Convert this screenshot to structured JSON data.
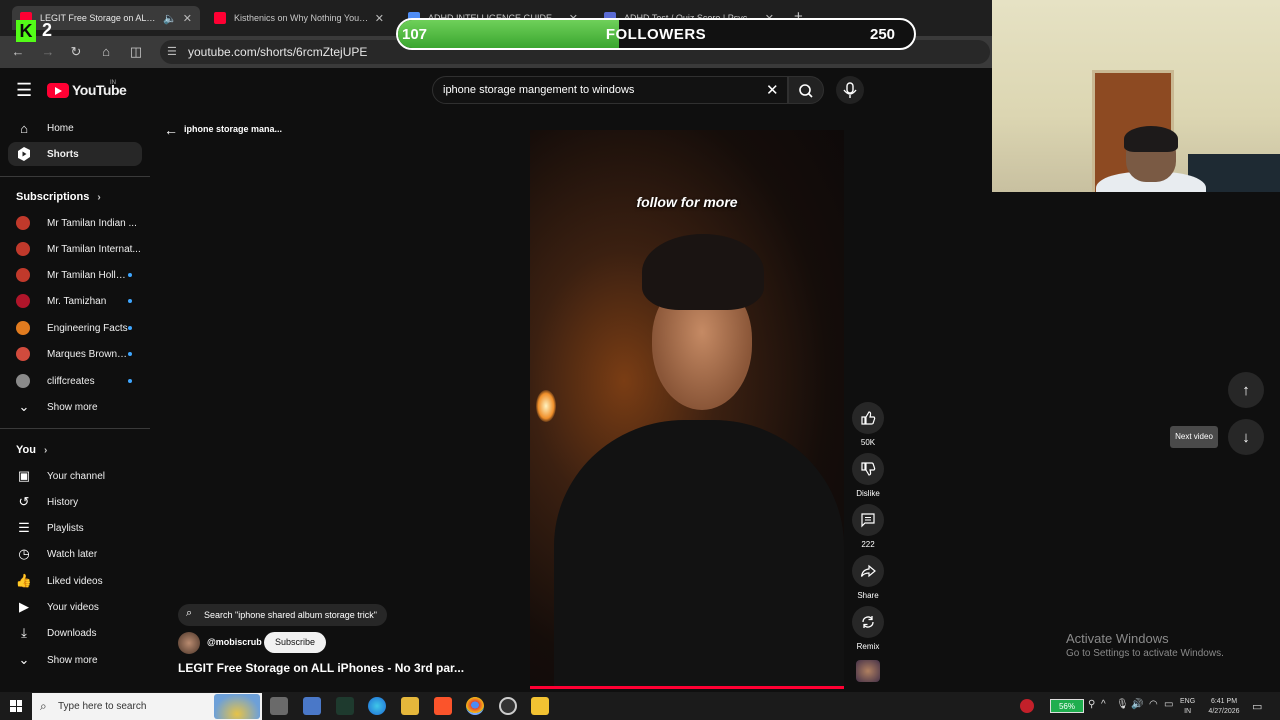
{
  "browser": {
    "tabs": [
      {
        "title": "LEGIT Free Storage on ALL iPhones",
        "favicon_color": "#ff0033",
        "active": true
      },
      {
        "title": "Kisthenics on Why Nothing You Chase",
        "favicon_color": "#ff0033",
        "active": false
      },
      {
        "title": "ADHD INTELLIGENCE GUIDE - Google",
        "favicon_color": "#4f8df5",
        "active": false
      },
      {
        "title": "ADHD Test / Quiz Score | Psychology",
        "favicon_color": "#5b6bd4",
        "active": false
      }
    ],
    "new_tab": "+",
    "url": "youtube.com/shorts/6rcmZtejUPE"
  },
  "overlay": {
    "kick_logo": "K",
    "kick_count": "2",
    "followers": {
      "current": "107",
      "label": "FOLLOWERS",
      "goal": "250",
      "progress_fraction": 0.428
    }
  },
  "header": {
    "logo_text": "YouTube",
    "logo_region": "IN",
    "search_value": "iphone storage mangement to windows"
  },
  "sidebar": {
    "main": [
      {
        "label": "Home",
        "icon": "home-icon"
      },
      {
        "label": "Shorts",
        "icon": "shorts-icon",
        "active": true
      }
    ],
    "subscriptions_title": "Subscriptions",
    "subscriptions": [
      {
        "label": "Mr Tamilan Indian ...",
        "color": "#c0392b",
        "dot": false
      },
      {
        "label": "Mr Tamilan Internat...",
        "color": "#c0392b",
        "dot": false
      },
      {
        "label": "Mr Tamilan Holly...",
        "color": "#c0392b",
        "dot": true
      },
      {
        "label": "Mr. Tamizhan",
        "color": "#b0152a",
        "dot": true
      },
      {
        "label": "Engineering Facts",
        "color": "#e07b1f",
        "dot": true
      },
      {
        "label": "Marques Brownlee",
        "color": "#d14b3d",
        "dot": true
      },
      {
        "label": "cliffcreates",
        "color": "#8a8a8a",
        "dot": true
      }
    ],
    "show_more_1": "Show more",
    "you_title": "You",
    "you_items": [
      {
        "label": "Your channel",
        "icon": "channel-icon"
      },
      {
        "label": "History",
        "icon": "history-icon"
      },
      {
        "label": "Playlists",
        "icon": "playlists-icon"
      },
      {
        "label": "Watch later",
        "icon": "watch-later-icon"
      },
      {
        "label": "Liked videos",
        "icon": "liked-icon"
      },
      {
        "label": "Your videos",
        "icon": "your-videos-icon"
      },
      {
        "label": "Downloads",
        "icon": "downloads-icon"
      }
    ],
    "show_more_2": "Show more"
  },
  "short": {
    "back_label": "iphone storage mana...",
    "caption": "follow for more",
    "search_tip": "Search \"iphone shared album storage trick\"",
    "channel": "@mobiscrub",
    "subscribe": "Subscribe",
    "title": "LEGIT Free Storage on ALL iPhones - No 3rd par...",
    "actions": {
      "likes": "50K",
      "dislike": "Dislike",
      "comments": "222",
      "share": "Share",
      "remix": "Remix"
    },
    "next_tip": "Next video"
  },
  "watermark": {
    "title": "Activate Windows",
    "subtitle": "Go to Settings to activate Windows."
  },
  "taskbar": {
    "search_placeholder": "Type here to search",
    "battery": "56%",
    "lang_1": "ENG",
    "lang_2": "IN",
    "time": "6:41 PM",
    "date": "4/27/2026"
  }
}
